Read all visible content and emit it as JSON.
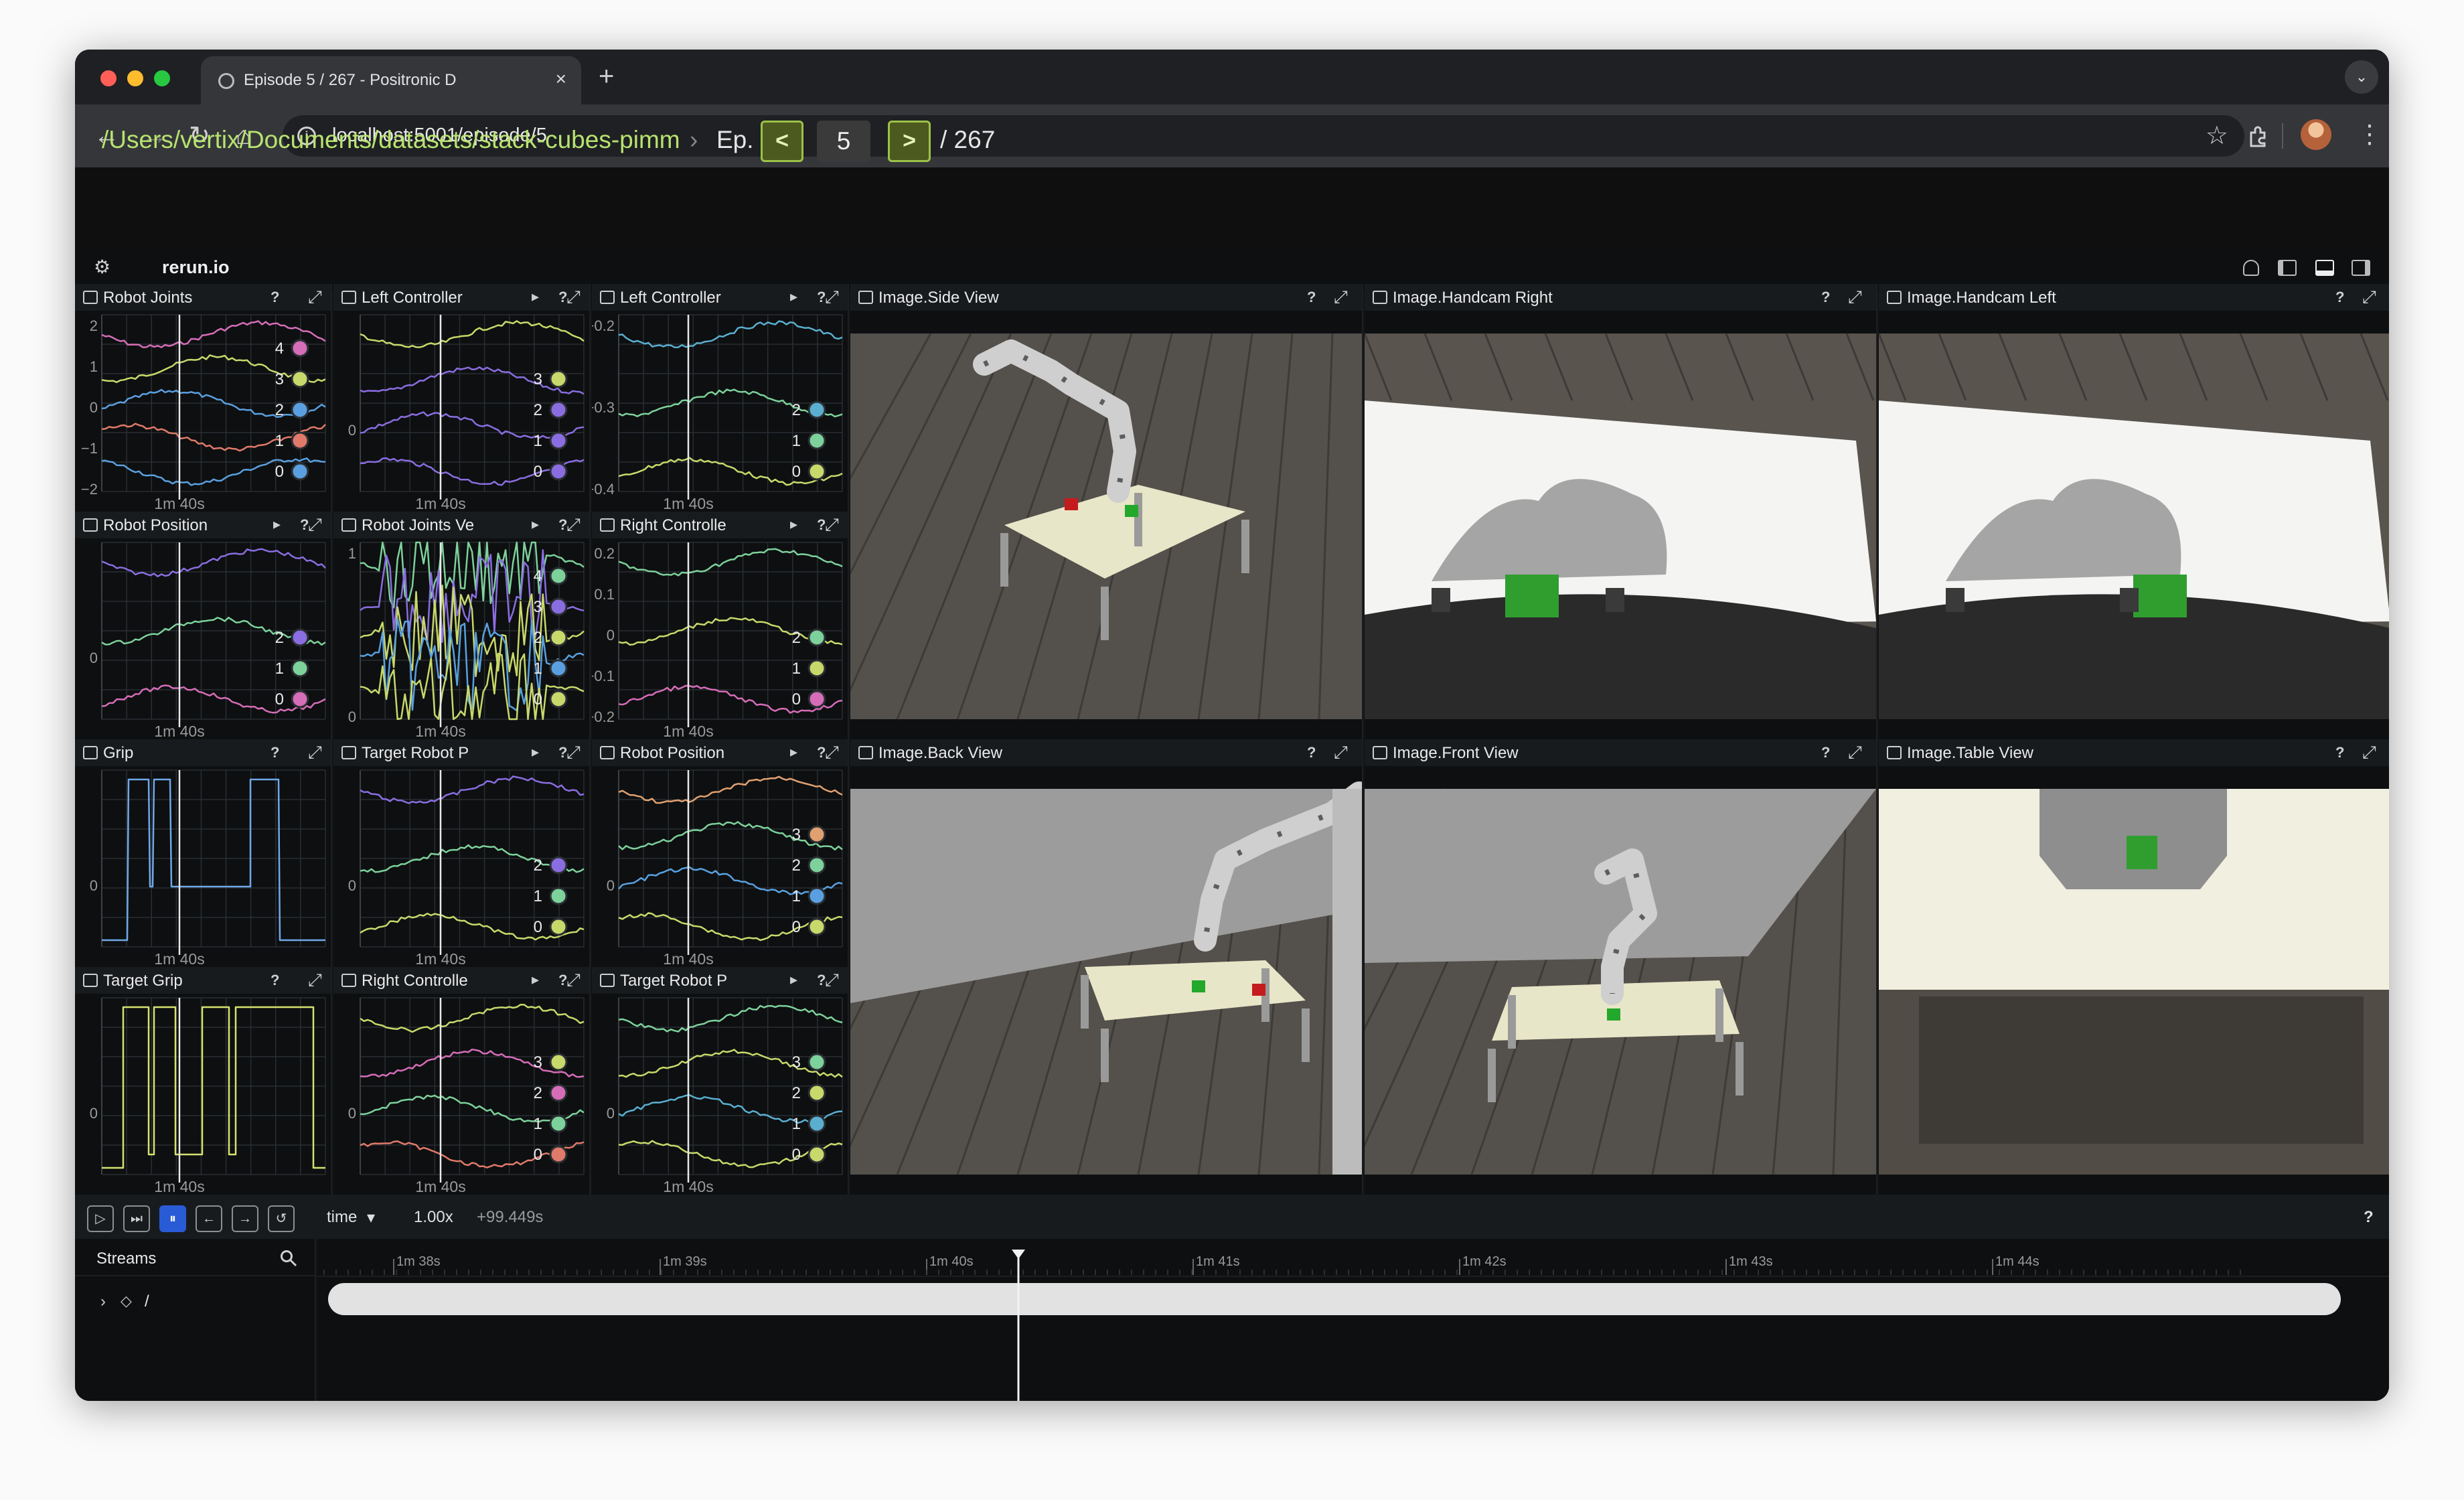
{
  "browser": {
    "tab_title": "Episode 5 / 267 - Positronic D",
    "tab_close": "×",
    "new_tab": "+",
    "url": "localhost:5001/episode/5",
    "back": "←",
    "forward": "→",
    "reload": "↻",
    "home": "⌂",
    "star": "☆",
    "menu": "⋮",
    "tab_menu": "⌄"
  },
  "header": {
    "path": "/Users/vertix/Documents/datasets/stack-cubes-pimm",
    "separator": "›",
    "ep_label": "Ep.",
    "prev_label": "<",
    "episode_number": "5",
    "next_label": ">",
    "total": "/ 267"
  },
  "rerun": {
    "logo": "rerun.io",
    "menu_icon": "⚙"
  },
  "panels": [
    {
      "title": "Robot Joints",
      "expand": "",
      "ticks": [
        "2",
        "1",
        "0",
        "−1",
        "−2"
      ],
      "legend": [
        "4",
        "3",
        "2",
        "1",
        "0"
      ],
      "time": "1m 40s"
    },
    {
      "title": "Left Controller",
      "expand": "▸",
      "ticks": [
        "0"
      ],
      "legend": [
        "3",
        "2",
        "1",
        "0"
      ],
      "time": "1m 40s"
    },
    {
      "title": "Left Controller",
      "expand": "▸",
      "ticks": [
        "−0.2",
        "−0.3",
        "−0.4"
      ],
      "legend": [
        "2",
        "1",
        "0"
      ],
      "time": "1m 40s"
    },
    {
      "title": "Robot Position",
      "expand": "▸",
      "ticks": [
        "0"
      ],
      "legend": [
        "2",
        "1",
        "0"
      ],
      "time": "1m 40s"
    },
    {
      "title": "Robot Joints Ve",
      "expand": "▸",
      "ticks": [
        "1",
        "0"
      ],
      "legend": [
        "4",
        "3",
        "2",
        "1",
        "0"
      ],
      "time": "1m 40s"
    },
    {
      "title": "Right Controlle",
      "expand": "▸",
      "ticks": [
        "0.2",
        "0.1",
        "0",
        "−0.1",
        "−0.2"
      ],
      "legend": [
        "2",
        "1",
        "0"
      ],
      "time": "1m 40s"
    },
    {
      "title": "Grip",
      "expand": "",
      "ticks": [
        "0"
      ],
      "legend": [],
      "time": "1m 40s"
    },
    {
      "title": "Target Robot P",
      "expand": "▸",
      "ticks": [
        "0"
      ],
      "legend": [
        "2",
        "1",
        "0"
      ],
      "time": "1m 40s"
    },
    {
      "title": "Robot Position",
      "expand": "▸",
      "ticks": [
        "0"
      ],
      "legend": [
        "3",
        "2",
        "1",
        "0"
      ],
      "time": "1m 40s"
    },
    {
      "title": "Target Grip",
      "expand": "",
      "ticks": [
        "0"
      ],
      "legend": [],
      "time": "1m 40s"
    },
    {
      "title": "Right Controlle",
      "expand": "▸",
      "ticks": [
        "0"
      ],
      "legend": [
        "3",
        "2",
        "1",
        "0"
      ],
      "time": "1m 40s"
    },
    {
      "title": "Target Robot P",
      "expand": "▸",
      "ticks": [
        "0"
      ],
      "legend": [
        "3",
        "2",
        "1",
        "0"
      ],
      "time": "1m 40s"
    }
  ],
  "images": [
    {
      "title": "Image.Side View"
    },
    {
      "title": "Image.Handcam Right"
    },
    {
      "title": "Image.Handcam Left"
    },
    {
      "title": "Image.Back View"
    },
    {
      "title": "Image.Front View"
    },
    {
      "title": "Image.Table View"
    }
  ],
  "common": {
    "help": "?",
    "maximize": "⤢"
  },
  "timeline": {
    "timeline_name": "time",
    "dropdown": "▾",
    "speed": "1.00x",
    "offset": "+99.449s",
    "help": "?",
    "streams_label": "Streams",
    "root_entity": "/",
    "ticks": [
      "1m 38s",
      "1m 39s",
      "1m 40s",
      "1m 41s",
      "1m 42s",
      "1m 43s",
      "1m 44s"
    ],
    "play": "▷",
    "step": "⏭",
    "pause": "⏸",
    "back": "←",
    "forward": "→",
    "loop": "↺"
  },
  "colors": {
    "accent": "#b7e36f",
    "series": [
      "#d56db8",
      "#8a6de0",
      "#5aa0e0",
      "#7dd19b",
      "#c8d86a",
      "#e07a6a"
    ]
  }
}
